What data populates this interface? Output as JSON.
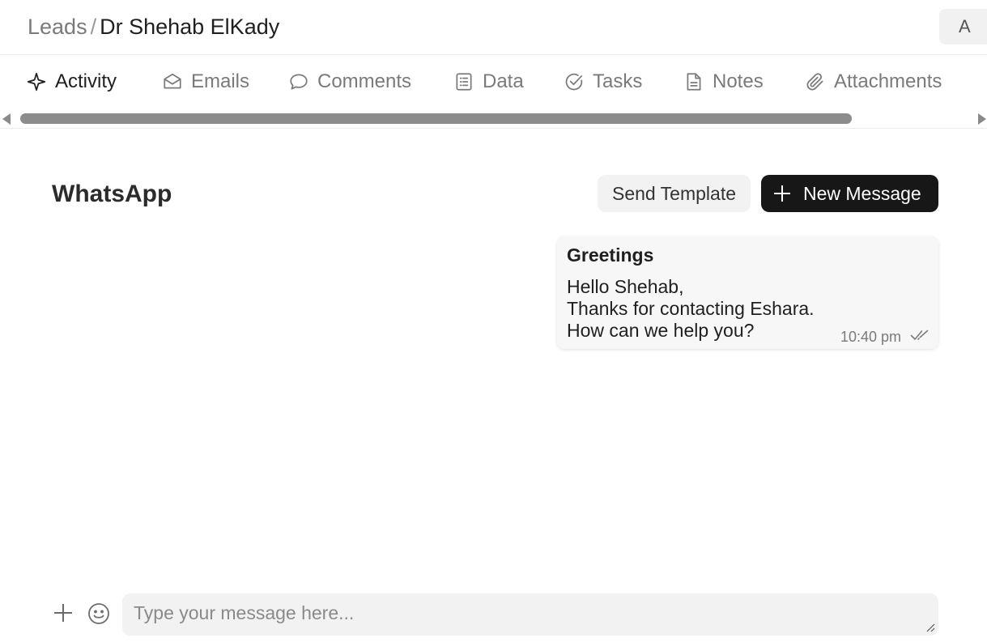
{
  "header": {
    "breadcrumb_parent": "Leads",
    "breadcrumb_separator": "/",
    "breadcrumb_current": "Dr Shehab ElKady",
    "avatar_letter": "A"
  },
  "tabs": [
    {
      "label": "Activity",
      "icon": "sparkle-icon",
      "active": true
    },
    {
      "label": "Emails",
      "icon": "envelope-icon",
      "active": false
    },
    {
      "label": "Comments",
      "icon": "chat-bubble-icon",
      "active": false
    },
    {
      "label": "Data",
      "icon": "list-document-icon",
      "active": false
    },
    {
      "label": "Tasks",
      "icon": "check-circle-icon",
      "active": false
    },
    {
      "label": "Notes",
      "icon": "note-icon",
      "active": false
    },
    {
      "label": "Attachments",
      "icon": "paperclip-icon",
      "active": false
    }
  ],
  "section": {
    "title": "WhatsApp",
    "send_template_label": "Send Template",
    "new_message_label": "New Message"
  },
  "messages": [
    {
      "title": "Greetings",
      "lines": [
        "Hello Shehab,",
        "Thanks for contacting Eshara.",
        "How can we help you?"
      ],
      "time": "10:40 pm",
      "status_icon": "double-check-icon"
    }
  ],
  "composer": {
    "placeholder": "Type your message here...",
    "value": ""
  },
  "colors": {
    "primary_button": "#171717",
    "muted_text": "#7a7a7a",
    "bubble_bg": "#f7f7f7"
  }
}
